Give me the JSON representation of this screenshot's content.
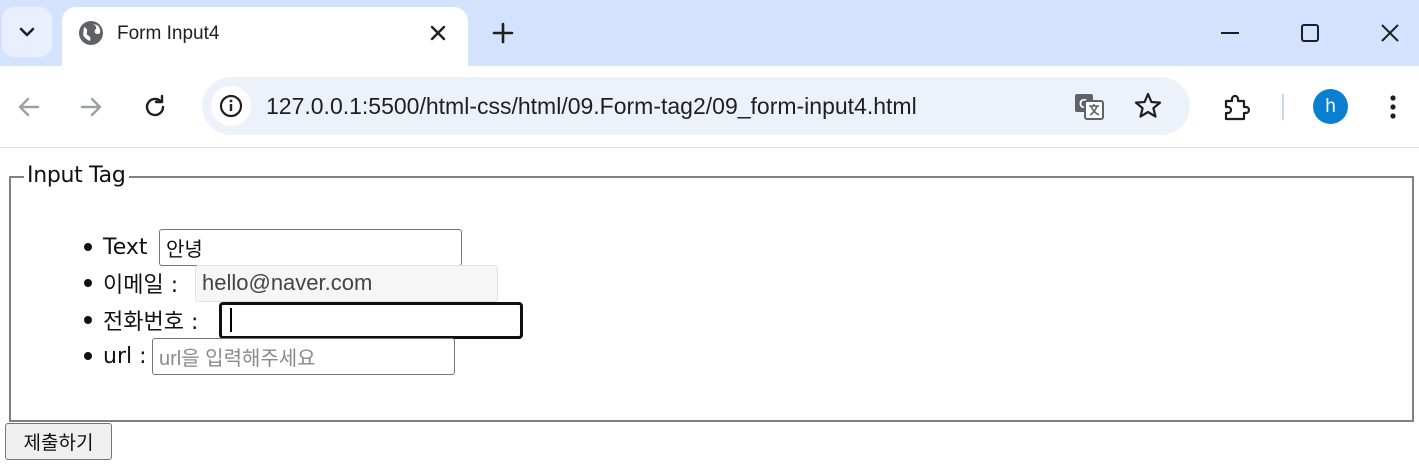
{
  "browser": {
    "tab": {
      "title": "Form Input4"
    },
    "omnibox": {
      "url": "127.0.0.1:5500/html-css/html/09.Form-tag2/09_form-input4.html"
    },
    "profile": {
      "initial": "h",
      "color": "#0b7fcf"
    },
    "icons": {
      "tab_search": "chevron-down-icon",
      "favicon": "globe-icon",
      "tab_close": "close-icon",
      "new_tab": "plus-icon",
      "back": "arrow-left-icon",
      "forward": "arrow-right-icon",
      "reload": "reload-icon",
      "site_info": "info-icon",
      "translate": "translate-icon",
      "bookmark": "star-icon",
      "extensions": "puzzle-icon",
      "menu": "kebab-icon"
    }
  },
  "form": {
    "legend": "Input Tag",
    "rows": [
      {
        "label": "Text",
        "value": "안녕"
      },
      {
        "label": "이메일 :",
        "value": "hello@naver.com",
        "disabled": true
      },
      {
        "label": "전화번호 :",
        "value": "",
        "focused": true
      },
      {
        "label": "url :",
        "placeholder": "url을 입력해주세요"
      }
    ],
    "submit_label": "제출하기"
  }
}
